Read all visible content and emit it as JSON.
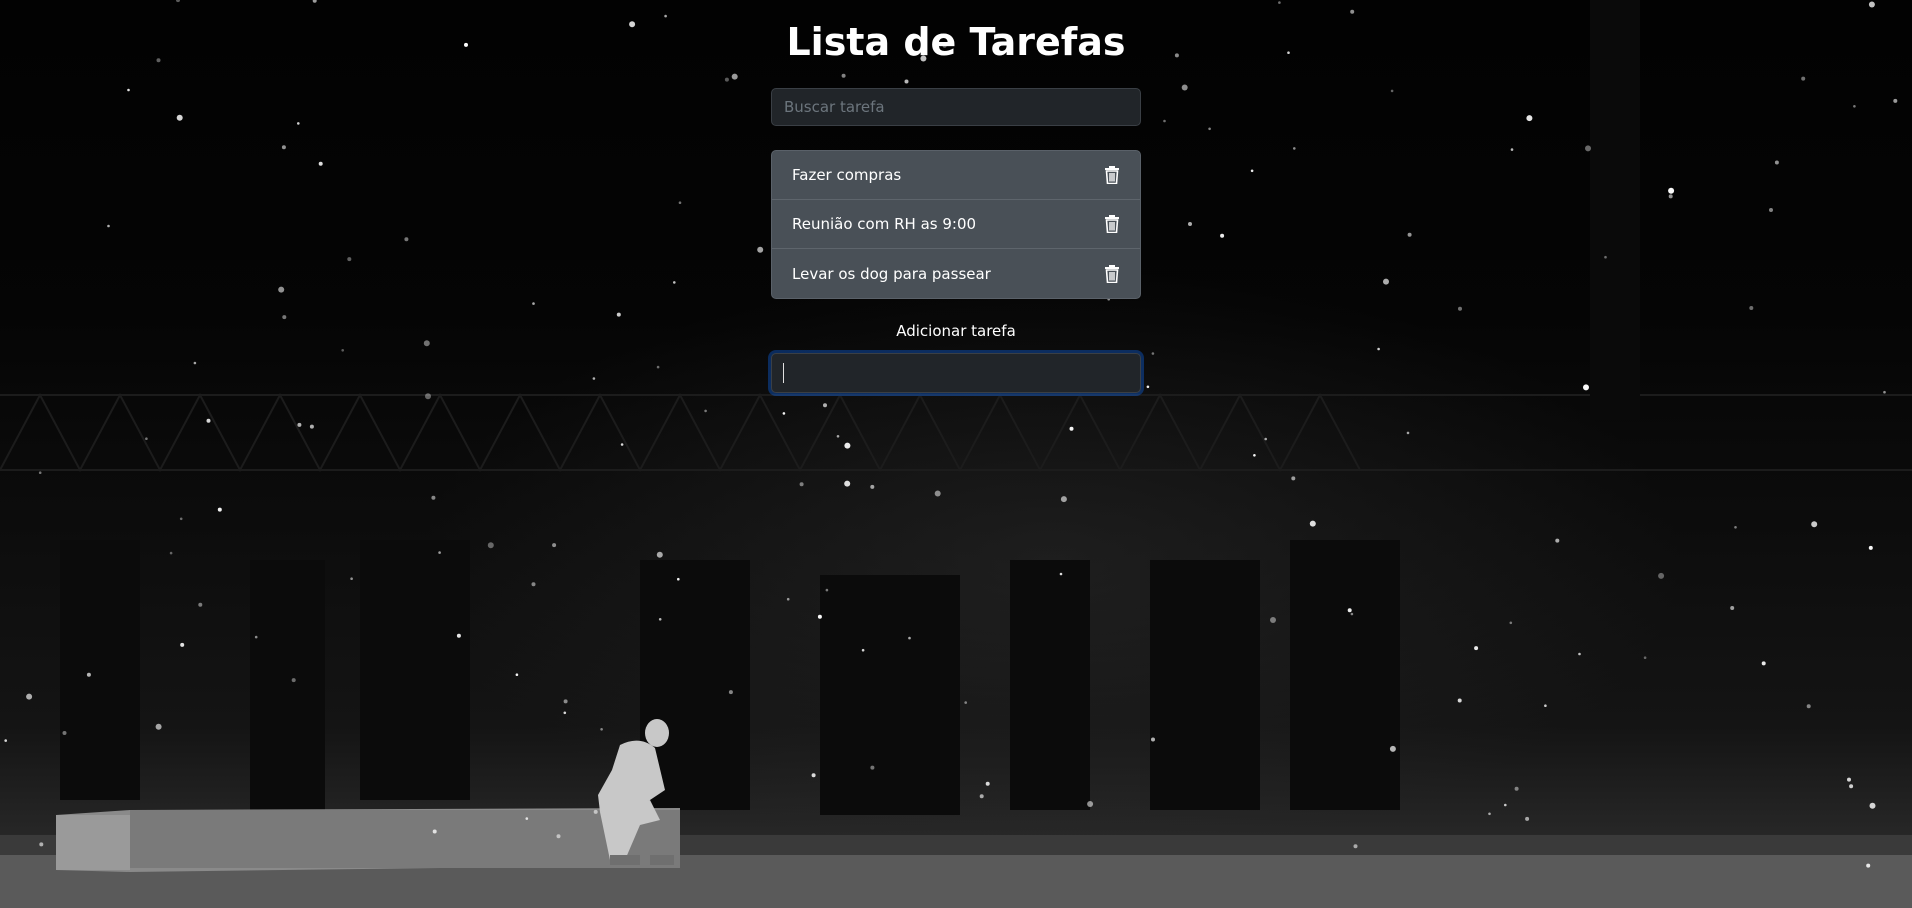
{
  "app": {
    "title": "Lista de Tarefas"
  },
  "search": {
    "placeholder": "Buscar tarefa",
    "value": ""
  },
  "todos": [
    {
      "label": "Fazer compras",
      "icon": "trash-icon"
    },
    {
      "label": "Reunião com RH as 9:00",
      "icon": "trash-icon"
    },
    {
      "label": "Levar os dog para passear",
      "icon": "trash-icon"
    }
  ],
  "add": {
    "label": "Adicionar tarefa",
    "value": ""
  },
  "colors": {
    "background": "#000000",
    "input_bg": "#212529",
    "list_bg": "#495057",
    "text": "#ffffff",
    "focus_ring": "#0d6efd"
  }
}
